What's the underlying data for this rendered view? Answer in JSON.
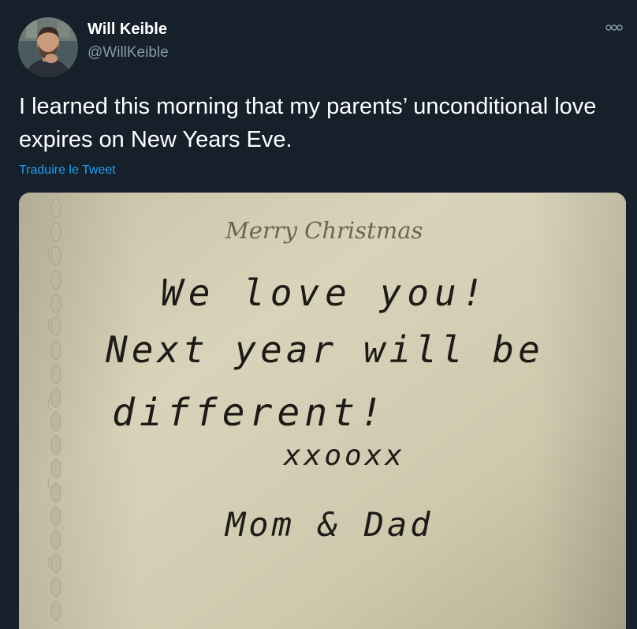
{
  "tweet": {
    "author": {
      "display_name": "Will Keible",
      "handle": "@WillKeible",
      "avatar_icon": "profile-photo"
    },
    "more_icon": "more-options-icon",
    "text": "I learned this morning that my parents’ unconditional love expires on New Years Eve.",
    "translate_label": "Traduire le Tweet"
  },
  "media": {
    "printed_heading": "Merry Christmas",
    "handwriting_lines": [
      "We love you!",
      "Next year will be",
      "different!",
      "xxooxx",
      "Mom & Dad"
    ]
  },
  "colors": {
    "background": "#15202b",
    "primary_text": "#ffffff",
    "secondary_text": "#8899a6",
    "link": "#1da1f2",
    "card_paper": "#cdc7ad"
  }
}
